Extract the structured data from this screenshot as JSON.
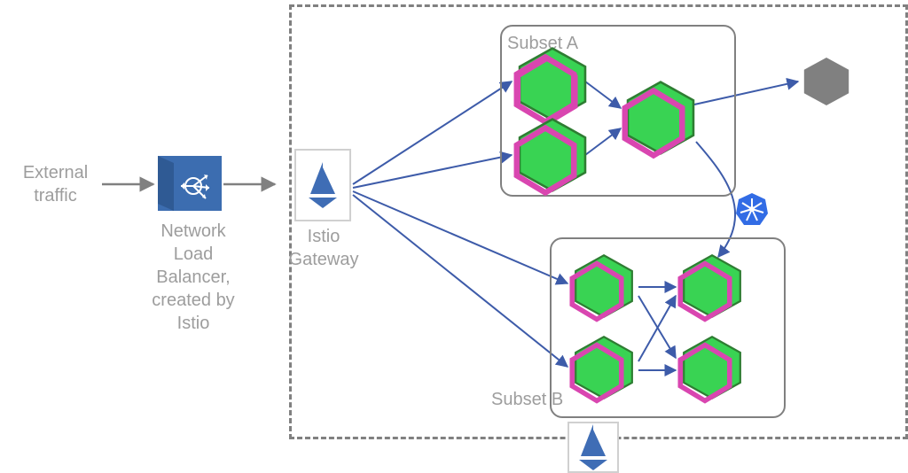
{
  "labels": {
    "external_traffic": "External\ntraffic",
    "nlb": "Network\nLoad\nBalancer,\ncreated by\nIstio",
    "gateway": "Istio\nGateway",
    "subset_a": "Subset A",
    "subset_b": "Subset B"
  },
  "icons": {
    "load_balancer": "load-balancer-icon",
    "istio_sail": "istio-sail-icon",
    "kubernetes": "kubernetes-icon",
    "pod_hexagon": "pod-hexagon-icon",
    "sidecar": "sidecar-icon",
    "external_service_hexagon": "external-service-hexagon-icon"
  },
  "colors": {
    "arrow": "#3d5ba9",
    "arrow_grey": "#808080",
    "pod_fill": "#39d353",
    "pod_stroke": "#2e7d32",
    "sidecar": "#d946b0",
    "grey_hex": "#808080",
    "lb_fill": "#3c6db0",
    "istio_blue": "#3f6db5",
    "k8s_blue": "#326ce5",
    "box_stroke": "#808080"
  },
  "diagram": {
    "cluster_boundary": true,
    "subsets": [
      {
        "id": "A",
        "pods": 3
      },
      {
        "id": "B",
        "pods": 4
      }
    ],
    "external_service": true,
    "arrows": [
      {
        "from": "external",
        "to": "nlb"
      },
      {
        "from": "nlb",
        "to": "gateway"
      },
      {
        "from": "gateway",
        "to": "A.pod1"
      },
      {
        "from": "gateway",
        "to": "A.pod2"
      },
      {
        "from": "gateway",
        "to": "B.pod1"
      },
      {
        "from": "gateway",
        "to": "B.pod2"
      },
      {
        "from": "A.pod1",
        "to": "A.pod3"
      },
      {
        "from": "A.pod2",
        "to": "A.pod3"
      },
      {
        "from": "A.pod3",
        "to": "external_service"
      },
      {
        "from": "A.pod3",
        "to": "B.pod4",
        "via": "k8s"
      },
      {
        "from": "B.pod1",
        "to": "B.pod3"
      },
      {
        "from": "B.pod1",
        "to": "B.pod4"
      },
      {
        "from": "B.pod2",
        "to": "B.pod3"
      },
      {
        "from": "B.pod2",
        "to": "B.pod4"
      }
    ]
  }
}
